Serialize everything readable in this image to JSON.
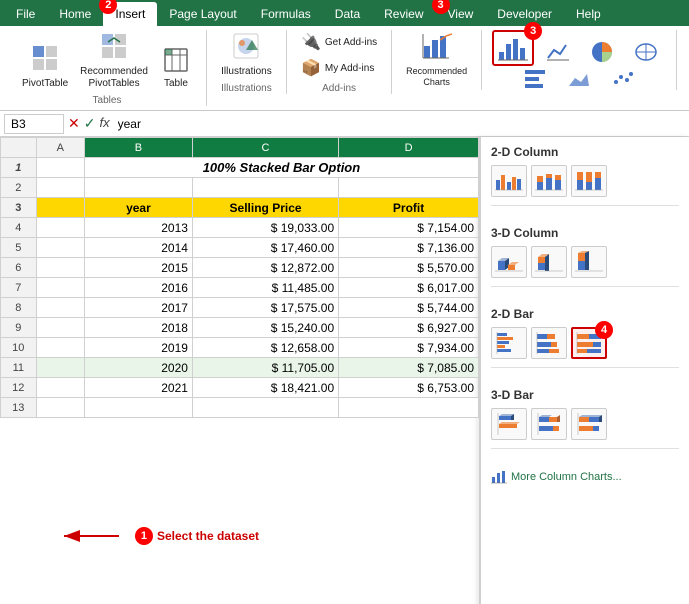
{
  "ribbon": {
    "tabs": [
      "File",
      "Home",
      "Insert",
      "Page Layout",
      "Formulas",
      "Data",
      "Review",
      "View",
      "Developer",
      "Help"
    ],
    "active_tab": "Insert",
    "groups": {
      "tables": {
        "label": "Tables",
        "buttons": [
          {
            "label": "PivotTable",
            "icon": "📊"
          },
          {
            "label": "Recommended\nPivotTables",
            "icon": "📋"
          },
          {
            "label": "Table",
            "icon": "⊞"
          }
        ]
      },
      "illustrations": {
        "label": "Illustrations",
        "buttons": [
          {
            "label": "Illustrations",
            "icon": "🖼"
          }
        ]
      },
      "addins": {
        "label": "Add-ins",
        "buttons": [
          {
            "label": "Get Add-ins",
            "icon": "🔌"
          },
          {
            "label": "My Add-ins",
            "icon": "📦"
          }
        ]
      },
      "charts": {
        "label": "",
        "buttons": [
          {
            "label": "Recommended\nCharts",
            "icon": "📈"
          }
        ]
      }
    }
  },
  "formula_bar": {
    "cell_ref": "B3",
    "formula": "year"
  },
  "title": "100% Stacked Bar Option",
  "columns": [
    "A",
    "B",
    "C",
    "D"
  ],
  "col_headers_display": [
    "",
    "A",
    "B",
    "C",
    "D"
  ],
  "headers": [
    "year",
    "Selling Price",
    "Profit"
  ],
  "data": [
    {
      "year": 2013,
      "price": "$    19,033.00",
      "profit": "$    7,154.00"
    },
    {
      "year": 2014,
      "price": "$    17,460.00",
      "profit": "$    7,136.00"
    },
    {
      "year": 2015,
      "price": "$    12,872.00",
      "profit": "$    5,570.00"
    },
    {
      "year": 2016,
      "price": "$    11,485.00",
      "profit": "$    6,017.00"
    },
    {
      "year": 2017,
      "price": "$    17,575.00",
      "profit": "$    5,744.00"
    },
    {
      "year": 2018,
      "price": "$    15,240.00",
      "profit": "$    6,927.00"
    },
    {
      "year": 2019,
      "price": "$    12,658.00",
      "profit": "$    7,934.00"
    },
    {
      "year": 2020,
      "price": "$    11,705.00",
      "profit": "$    7,085.00"
    },
    {
      "year": 2021,
      "price": "$    18,421.00",
      "profit": "$    6,753.00"
    }
  ],
  "panel": {
    "sections": [
      {
        "title": "2-D Column",
        "charts": [
          "clustered-column",
          "stacked-column",
          "100pct-stacked-column"
        ]
      },
      {
        "title": "3-D Column",
        "charts": [
          "3d-clustered-column",
          "3d-stacked-column",
          "3d-100pct-stacked-column"
        ]
      },
      {
        "title": "2-D Bar",
        "charts": [
          "clustered-bar",
          "stacked-bar",
          "100pct-stacked-bar"
        ],
        "selected": 2
      },
      {
        "title": "3-D Bar",
        "charts": [
          "3d-clustered-bar",
          "3d-stacked-bar",
          "3d-100pct-stacked-bar"
        ]
      }
    ],
    "more_link": "More Column Charts..."
  },
  "badges": {
    "insert_num": "2",
    "view_num": "3",
    "panel_num": "4",
    "annotation_num": "1",
    "annotation_text": "Select the dataset"
  }
}
